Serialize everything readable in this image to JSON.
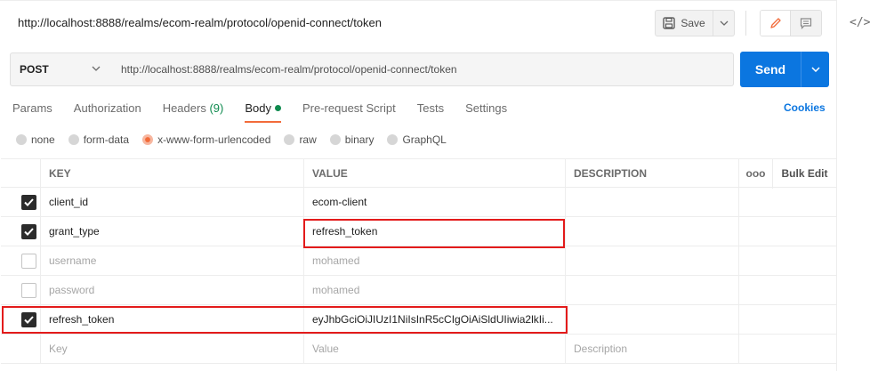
{
  "request": {
    "title": "http://localhost:8888/realms/ecom-realm/protocol/openid-connect/token",
    "method": "POST",
    "url": "http://localhost:8888/realms/ecom-realm/protocol/openid-connect/token"
  },
  "toolbar": {
    "save_label": "Save",
    "send_label": "Send"
  },
  "tabs": [
    {
      "label": "Params"
    },
    {
      "label": "Authorization"
    },
    {
      "label": "Headers",
      "count": "(9)"
    },
    {
      "label": "Body",
      "active": true
    },
    {
      "label": "Pre-request Script"
    },
    {
      "label": "Tests"
    },
    {
      "label": "Settings"
    }
  ],
  "cookies_label": "Cookies",
  "body_types": [
    {
      "label": "none"
    },
    {
      "label": "form-data"
    },
    {
      "label": "x-www-form-urlencoded",
      "selected": true
    },
    {
      "label": "raw"
    },
    {
      "label": "binary"
    },
    {
      "label": "GraphQL"
    }
  ],
  "table": {
    "headers": {
      "key": "KEY",
      "value": "VALUE",
      "description": "DESCRIPTION",
      "more": "ooo",
      "bulk_edit": "Bulk Edit"
    },
    "rows": [
      {
        "checked": true,
        "key": "client_id",
        "value": "ecom-client",
        "description": ""
      },
      {
        "checked": true,
        "key": "grant_type",
        "value": "refresh_token",
        "description": ""
      },
      {
        "checked": false,
        "key": "username",
        "value": "mohamed",
        "description": ""
      },
      {
        "checked": false,
        "key": "password",
        "value": "mohamed",
        "description": ""
      },
      {
        "checked": true,
        "key": "refresh_token",
        "value": "eyJhbGciOiJIUzI1NiIsInR5cCIgOiAiSldUIiwia2lkIi...",
        "description": ""
      }
    ],
    "placeholder": {
      "key": "Key",
      "value": "Value",
      "description": "Description"
    }
  },
  "colors": {
    "accent": "#f26b3a",
    "send": "#0b76e0",
    "highlight": "#e31b1b",
    "active_green": "#0e8a4e"
  }
}
